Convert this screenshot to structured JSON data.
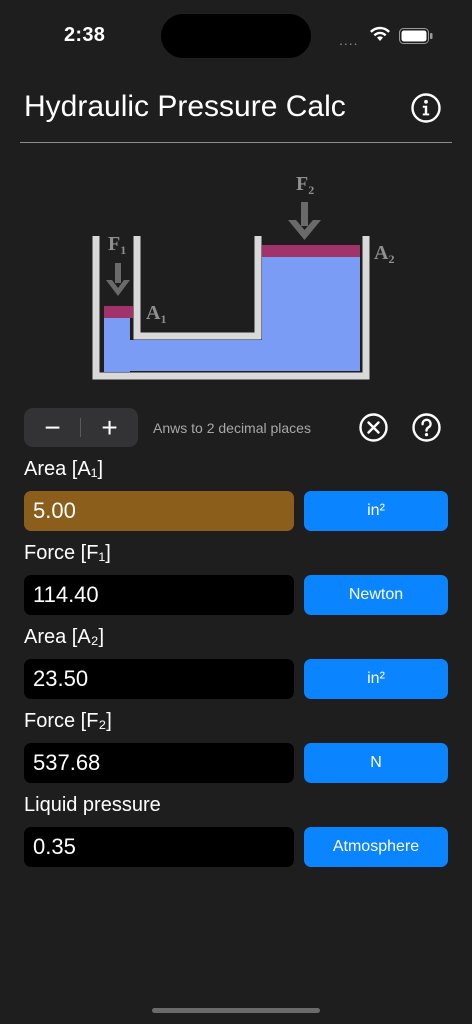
{
  "status_bar": {
    "time": "2:38",
    "signal": "...."
  },
  "header": {
    "title": "Hydraulic Pressure Calc"
  },
  "diagram": {
    "labels": {
      "f1": "F",
      "f1_sub": "1",
      "f2": "F",
      "f2_sub": "2",
      "a1": "A",
      "a1_sub": "1",
      "a2": "A",
      "a2_sub": "2"
    },
    "colors": {
      "container": "#d9d9d9",
      "liquid": "#7b9cf5",
      "piston": "#a2336a",
      "arrow": "#6a6a6a"
    }
  },
  "controls": {
    "minus": "−",
    "plus": "+",
    "precision_text": "Anws to 2 decimal places"
  },
  "fields": [
    {
      "label": "Area [A₁]",
      "value": "5.00",
      "unit": "in²",
      "active": true
    },
    {
      "label": "Force [F₁]",
      "value": "114.40",
      "unit": "Newton",
      "active": false
    },
    {
      "label": "Area [A₂]",
      "value": "23.50",
      "unit": "in²",
      "active": false
    },
    {
      "label": "Force [F₂]",
      "value": "537.68",
      "unit": "N",
      "active": false
    },
    {
      "label": "Liquid pressure",
      "value": "0.35",
      "unit": "Atmosphere",
      "active": false
    }
  ],
  "colors": {
    "accent": "#0a84ff",
    "active_field": "#8c5e1b",
    "background": "#1e1e1f"
  }
}
